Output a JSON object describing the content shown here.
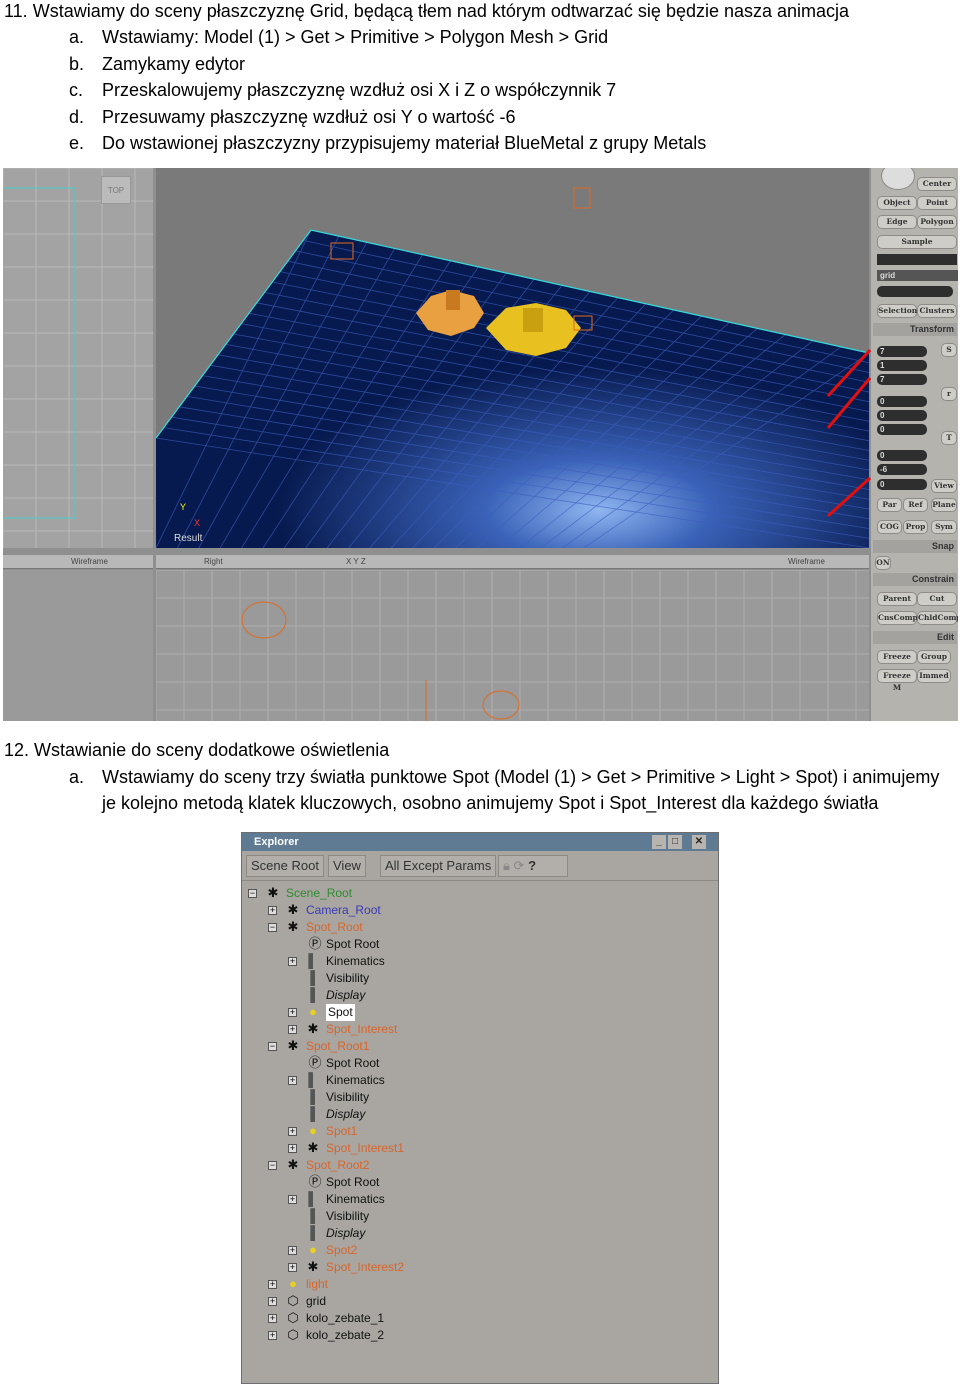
{
  "step11": {
    "num": "11.",
    "text": "Wstawiamy do sceny płaszczyznę Grid, będącą tłem nad którym odtwarzać się będzie nasza animacja",
    "items": [
      {
        "letter": "a.",
        "text": "Wstawiamy: Model (1) > Get > Primitive > Polygon Mesh > Grid"
      },
      {
        "letter": "b.",
        "text": "Zamykamy edytor"
      },
      {
        "letter": "c.",
        "text": "Przeskalowujemy płaszczyznę wzdłuż osi X i Z o współczynnik 7"
      },
      {
        "letter": "d.",
        "text": "Przesuwamy płaszczyznę wzdłuż osi Y o wartość -6"
      },
      {
        "letter": "e.",
        "text": "Do wstawionej płaszczyzny przypisujemy materiał BlueMetal z grupy Metals"
      }
    ]
  },
  "viewport": {
    "top_label": "TOP",
    "result_label": "Result",
    "wireframe_label": "Wireframe",
    "right_label": "Right",
    "axes": "X Y Z",
    "axis_y": "Y",
    "axis_x": "X"
  },
  "panel": {
    "center": "Center",
    "object": "Object",
    "point": "Point",
    "edge": "Edge",
    "polygon": "Polygon",
    "sample": "Sample",
    "selected": "grid",
    "selection": "Selection",
    "clusters": "Clusters",
    "transform": "Transform",
    "scale": [
      "7",
      "1",
      "7"
    ],
    "rotate": [
      "0",
      "0",
      "0"
    ],
    "translate": [
      "0",
      "-6",
      "0"
    ],
    "s": "S",
    "r": "r",
    "t": "T",
    "view": "View",
    "par": "Par",
    "ref": "Ref",
    "plane": "Plane",
    "cog": "COG",
    "prop": "Prop",
    "sym": "Sym",
    "snap": "Snap",
    "on": "ON",
    "constrain": "Constrain",
    "parent": "Parent",
    "cut": "Cut",
    "cnscomp": "CnsComp",
    "chldcomp": "ChldComp",
    "edit": "Edit",
    "freeze": "Freeze",
    "group": "Group",
    "freezem": "Freeze M",
    "immed": "Immed",
    "arrow_color": "#e01010"
  },
  "step12": {
    "num": "12.",
    "text": "Wstawianie do sceny dodatkowe oświetlenia",
    "item": {
      "letter": "a.",
      "line1": "Wstawiamy do sceny trzy światła punktowe Spot (Model (1) > Get > Primitive > Light > Spot) i animujemy",
      "line2": "je kolejno metodą klatek kluczowych, osobno animujemy Spot i Spot_Interest dla każdego światła"
    }
  },
  "explorer": {
    "title": "Explorer",
    "scope": "Scene Root",
    "view": "View",
    "filter": "All Except Params",
    "tree": [
      {
        "label": "Scene_Root",
        "level": 0,
        "exp": "-",
        "icon": "null-icon",
        "color": "#2e8b2e"
      },
      {
        "label": "Camera_Root",
        "level": 1,
        "exp": "+",
        "icon": "camera-root-icon",
        "color": "#3a3ab0"
      },
      {
        "label": "Spot_Root",
        "level": 1,
        "exp": "-",
        "icon": "null-icon",
        "color": "#d9652a"
      },
      {
        "label": "Spot Root",
        "level": 2,
        "exp": "",
        "icon": "property-icon",
        "color": "#111"
      },
      {
        "label": "Kinematics",
        "level": 2,
        "exp": "+",
        "icon": "gradient-icon",
        "color": "#111"
      },
      {
        "label": "Visibility",
        "level": 2,
        "exp": "",
        "icon": "gradient-icon",
        "color": "#111"
      },
      {
        "label": "Display",
        "level": 2,
        "exp": "",
        "icon": "gradient-icon",
        "color": "#111",
        "italic": true
      },
      {
        "label": "Spot",
        "level": 2,
        "exp": "+",
        "icon": "spotlight-icon",
        "color": "#111",
        "selected": true
      },
      {
        "label": "Spot_Interest",
        "level": 2,
        "exp": "+",
        "icon": "null-icon",
        "color": "#d9652a"
      },
      {
        "label": "Spot_Root1",
        "level": 1,
        "exp": "-",
        "icon": "null-icon",
        "color": "#d9652a"
      },
      {
        "label": "Spot Root",
        "level": 2,
        "exp": "",
        "icon": "property-icon",
        "color": "#111"
      },
      {
        "label": "Kinematics",
        "level": 2,
        "exp": "+",
        "icon": "gradient-icon",
        "color": "#111"
      },
      {
        "label": "Visibility",
        "level": 2,
        "exp": "",
        "icon": "gradient-icon",
        "color": "#111"
      },
      {
        "label": "Display",
        "level": 2,
        "exp": "",
        "icon": "gradient-icon",
        "color": "#111",
        "italic": true
      },
      {
        "label": "Spot1",
        "level": 2,
        "exp": "+",
        "icon": "spotlight-icon",
        "color": "#d9652a"
      },
      {
        "label": "Spot_Interest1",
        "level": 2,
        "exp": "+",
        "icon": "null-icon",
        "color": "#d9652a"
      },
      {
        "label": "Spot_Root2",
        "level": 1,
        "exp": "-",
        "icon": "null-icon",
        "color": "#d9652a"
      },
      {
        "label": "Spot Root",
        "level": 2,
        "exp": "",
        "icon": "property-icon",
        "color": "#111"
      },
      {
        "label": "Kinematics",
        "level": 2,
        "exp": "+",
        "icon": "gradient-icon",
        "color": "#111"
      },
      {
        "label": "Visibility",
        "level": 2,
        "exp": "",
        "icon": "gradient-icon",
        "color": "#111"
      },
      {
        "label": "Display",
        "level": 2,
        "exp": "",
        "icon": "gradient-icon",
        "color": "#111",
        "italic": true
      },
      {
        "label": "Spot2",
        "level": 2,
        "exp": "+",
        "icon": "spotlight-icon",
        "color": "#d9652a"
      },
      {
        "label": "Spot_Interest2",
        "level": 2,
        "exp": "+",
        "icon": "null-icon",
        "color": "#d9652a"
      },
      {
        "label": "light",
        "level": 1,
        "exp": "+",
        "icon": "light-icon",
        "color": "#d9652a"
      },
      {
        "label": "grid",
        "level": 1,
        "exp": "+",
        "icon": "mesh-icon",
        "color": "#111"
      },
      {
        "label": "kolo_zebate_1",
        "level": 1,
        "exp": "+",
        "icon": "mesh-icon",
        "color": "#111"
      },
      {
        "label": "kolo_zebate_2",
        "level": 1,
        "exp": "+",
        "icon": "mesh-icon",
        "color": "#111"
      }
    ]
  }
}
